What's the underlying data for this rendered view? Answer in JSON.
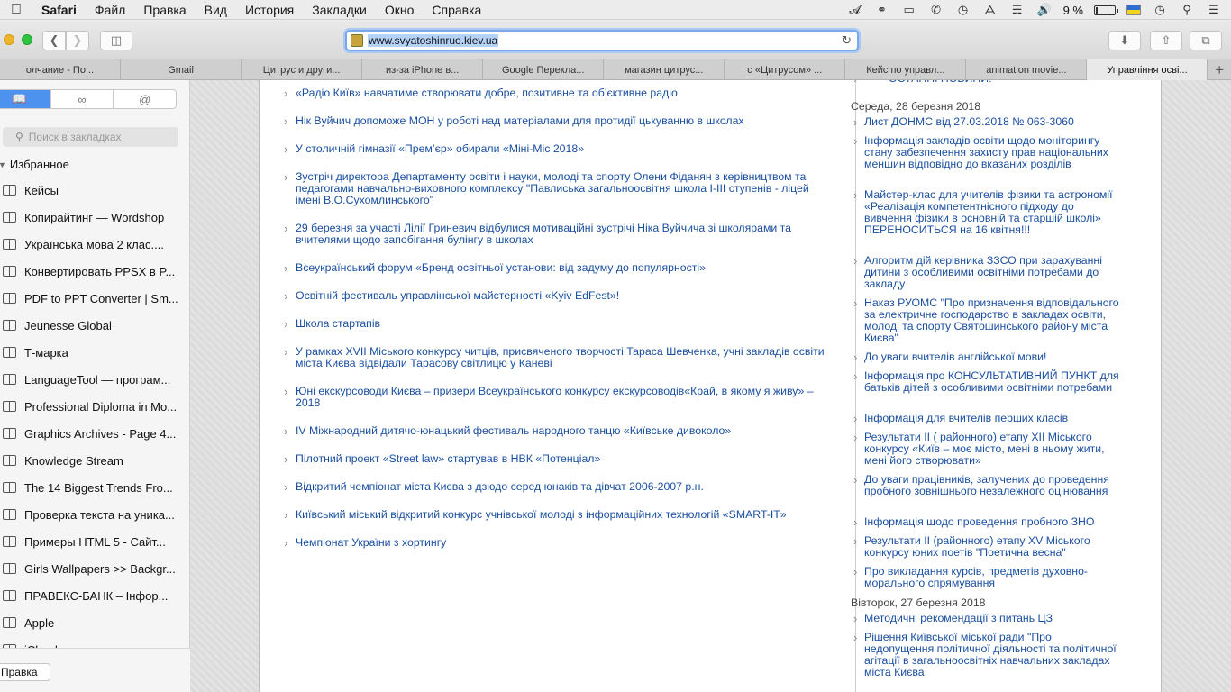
{
  "menubar": {
    "app": "Safari",
    "items": [
      "Файл",
      "Правка",
      "Вид",
      "История",
      "Закладки",
      "Окно",
      "Справка"
    ],
    "battery_text": "9 %"
  },
  "toolbar": {
    "url": "www.svyatoshinruo.kiev.ua"
  },
  "tabs": [
    {
      "label": "олчание - По..."
    },
    {
      "label": "Gmail"
    },
    {
      "label": "Цитрус и други..."
    },
    {
      "label": "из-за iPhone в..."
    },
    {
      "label": "Google Перекла..."
    },
    {
      "label": "магазин цитрус..."
    },
    {
      "label": "с «Цитрусом» ..."
    },
    {
      "label": "Кейс по управл..."
    },
    {
      "label": "animation movie..."
    },
    {
      "label": "Управління осві..."
    }
  ],
  "sidebar": {
    "search_placeholder": "Поиск в закладках",
    "favorites_label": "Избранное",
    "edit_label": "Правка",
    "bookmarks": [
      "Кейсы",
      "Копирайтинг — Wordshop",
      "Українська мова 2 клас....",
      "Конвертировать PPSX в P...",
      "PDF to PPT Converter | Sm...",
      "Jeunesse Global",
      "Т-марка",
      "LanguageTool — програм...",
      "Professional Diploma in Mo...",
      "Graphics Archives - Page 4...",
      "Knowledge Stream",
      "The 14 Biggest Trends Fro...",
      "Проверка текста на уника...",
      "Примеры HTML 5 - Сайт...",
      "Girls Wallpapers >> Backgr...",
      "ПРАВЕКС-БАНК – Інфор...",
      "Apple",
      "iCloud"
    ]
  },
  "news": [
    "«Радіо Київ» навчатиме створювати добре, позитивне та об’єктивне радіо",
    "Нік Вуйчич допоможе МОН у роботі над матеріалами для протидії цькуванню в школах",
    "У столичній гімназії «Прем’єр» обирали «Міні-Міс 2018»",
    "Зустріч директора Департаменту освіти і науки, молоді та спорту Олени Фіданян з керівництвом та педагогами навчально-виховного комплексу \"Павлиська загальноосвітня школа I-III ступенів - ліцей імені В.О.Сухомлинського\"",
    "29 березня за участі Лілії Гриневич відбулися мотиваційні зустрічі Ніка Вуйчича зі школярами та вчителями щодо запобігання булінгу в школах",
    "Всеукраїнський форум «Бренд освітньої установи: від задуму до популярності»",
    "Освітній фестиваль управлінської майстерності «Kyiv EdFest»!",
    "Школа стартапів",
    "У рамках XVII Міського конкурсу читців, присвяченого творчості Тараса Шевченка, учні закладів освіти міста Києва відвідали Тарасову світлицю у Каневі",
    "Юні екскурсоводи Києва – призери Всеукраїнського конкурсу екскурсоводів«Край, в якому я живу» – 2018",
    "IV Міжнародний дитячо-юнацький фестиваль народного танцю «Київське дивоколо»",
    "Пілотний проект «Street law» стартував в НВК «Потенціал»",
    "Відкритий чемпіонат міста Києва з дзюдо серед юнаків та дівчат 2006-2007 р.н.",
    "Київський міський відкритий конкурс учнівської молоді з інформаційних технологій «SMART-IT»",
    "Чемпіонат України з хортингу"
  ],
  "side_news": {
    "top_partial": "ОСТАННІ НОВИНИ!",
    "groups": [
      {
        "date": "Середа, 28 березня 2018",
        "items": [
          "Лист ДОНМС від 27.03.2018 № 063-3060",
          "Інформація закладів освіти щодо моніторингу стану забезпечення захисту прав національних меншин відповідно до вказаних розділів",
          "Майстер-клас для учителів фізики та астрономії «Реалізація компетентнісного підходу до вивчення фізики в основній та старшій школі» ПЕРЕНОСИТЬСЯ на 16 квітня!!!",
          "Алгоритм дій керівника ЗЗСО при зарахуванні дитини з особливими освітніми потребами до закладу",
          "Наказ РУОМС \"Про призначення відповідального за електричне господарство в закладах освіти, молоді та спорту Святошинського району міста Києва\"",
          "До уваги вчителів англійської мови!",
          "Інформація про КОНСУЛЬТАТИВНИЙ ПУНКТ для батьків дітей з особливими освітніми потребами",
          "Інформація для вчителів перших класів",
          "Результати II ( районного) етапу XII Міського конкурсу «Київ – моє місто, мені в ньому жити, мені його створювати»",
          "До уваги працівників, залучених до проведення пробного зовнішнього незалежного оцінювання",
          "Інформація щодо проведення пробного ЗНО",
          "Результати II (районного) етапу XV Міського конкурсу юних поетів \"Поетична весна\"",
          "Про викладання курсів, предметів духовно-морального спрямування"
        ]
      },
      {
        "date": "Вівторок, 27 березня 2018",
        "items": [
          "Методичні рекомендації з питань ЦЗ",
          "Рішення Київської міської ради \"Про недопущення політичної діяльності та політичної агітації в загальноосвітніх навчальних закладах міста Києва"
        ]
      }
    ]
  }
}
